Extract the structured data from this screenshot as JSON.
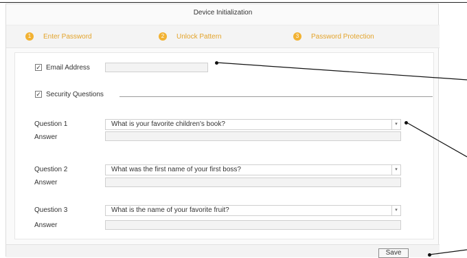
{
  "dialog": {
    "title": "Device Initialization"
  },
  "steps": [
    {
      "number": "1",
      "label": "Enter Password"
    },
    {
      "number": "2",
      "label": "Unlock Pattern"
    },
    {
      "number": "3",
      "label": "Password Protection"
    }
  ],
  "email": {
    "label": "Email Address",
    "checked": true,
    "value": ""
  },
  "security": {
    "label": "Security Questions",
    "checked": true
  },
  "questions": [
    {
      "label": "Question 1",
      "selected": "What is your favorite children's book?",
      "answer_label": "Answer",
      "answer": ""
    },
    {
      "label": "Question 2",
      "selected": "What was the first name of your first boss?",
      "answer_label": "Answer",
      "answer": ""
    },
    {
      "label": "Question 3",
      "selected": "What is the name of your favorite fruit?",
      "answer_label": "Answer",
      "answer": ""
    }
  ],
  "footer": {
    "save_label": "Save"
  },
  "colors": {
    "accent": "#f2b233",
    "step_text": "#e3a32a"
  },
  "icons": {
    "checkbox": "checkmark-icon",
    "dropdown": "chevron-down-icon"
  }
}
